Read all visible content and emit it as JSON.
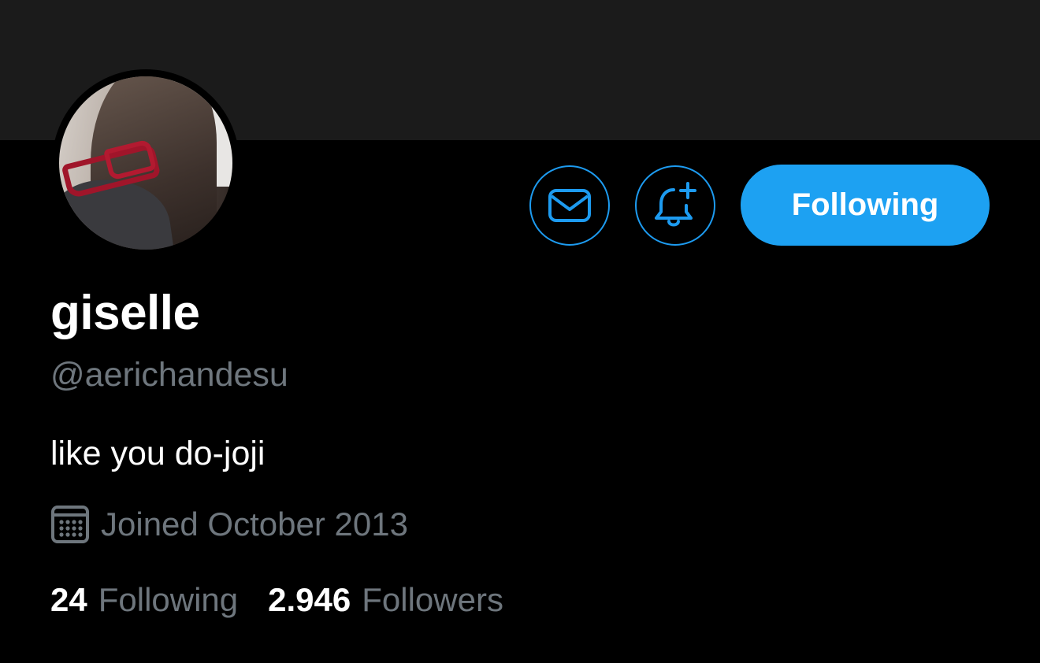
{
  "profile": {
    "display_name": "giselle",
    "handle": "@aerichandesu",
    "bio": "like you do-joji",
    "joined": "Joined October 2013"
  },
  "actions": {
    "message_icon": "mail-icon",
    "notify_icon": "bell-plus-icon",
    "follow_label": "Following"
  },
  "stats": {
    "following_count": "24",
    "following_label": "Following",
    "followers_count": "2.946",
    "followers_label": "Followers"
  },
  "colors": {
    "accent": "#1da1f2",
    "muted_text": "#6e767d",
    "banner": "#1b1b1b",
    "background": "#000000"
  }
}
